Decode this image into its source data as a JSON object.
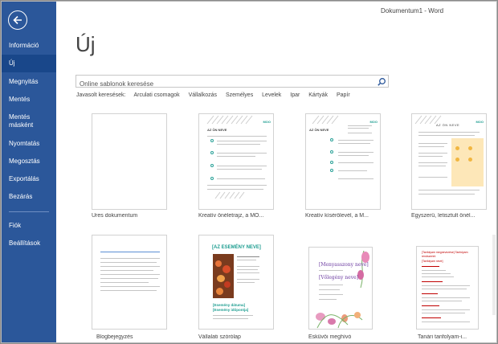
{
  "window": {
    "title": "Dokumentum1 - Word"
  },
  "sidebar": {
    "items": [
      {
        "label": "Információ"
      },
      {
        "label": "Új"
      },
      {
        "label": "Megnyitás"
      },
      {
        "label": "Mentés"
      },
      {
        "label": "Mentés\nmásként"
      },
      {
        "label": "Nyomtatás"
      },
      {
        "label": "Megosztás"
      },
      {
        "label": "Exportálás"
      },
      {
        "label": "Bezárás"
      },
      {
        "label": "Fiók"
      },
      {
        "label": "Beállítások"
      }
    ]
  },
  "main": {
    "title": "Új",
    "search_placeholder": "Online sablonok keresése",
    "suggested_label": "Javasolt keresések:",
    "suggested": [
      "Arculati csomagok",
      "Vállalkozás",
      "Személyes",
      "Levelek",
      "Ipar",
      "Kártyák",
      "Papír"
    ]
  },
  "templates": [
    {
      "label": "Üres dokumentum"
    },
    {
      "label": "Kreatív önéletrajz, a MO...",
      "header": "AZ ÖN NEVE",
      "brand": "MOO"
    },
    {
      "label": "Kreatív kísérőlevél, a M...",
      "header": "AZ ÖN NEVE",
      "brand": "MOO"
    },
    {
      "label": "Egyszerű, letisztult önél...",
      "header": "AZ ÖN NEVE",
      "brand": "MOO"
    },
    {
      "label": "Blogbejegyzés"
    },
    {
      "label": "Vállalati szórólap",
      "header": "[AZ ESEMÉNY NEVE]",
      "sub": "[Esemény dátuma] [Esemény időpontja]"
    },
    {
      "label": "Esküvői meghívó",
      "line1": "[Menyasszony neve]",
      "line2": "[Vőlegény neve]"
    },
    {
      "label": "Tanári tanfolyam-i...",
      "header": "[Tanfolyam megnevezése] Tanfolyam rendszerint",
      "sub": "[Tanfolyam neve]"
    }
  ],
  "colors": {
    "sidebar": "#2b579a",
    "sidebar_active": "#19478a",
    "accent_teal": "#1f9e91",
    "accent_orange": "#f1b640"
  }
}
